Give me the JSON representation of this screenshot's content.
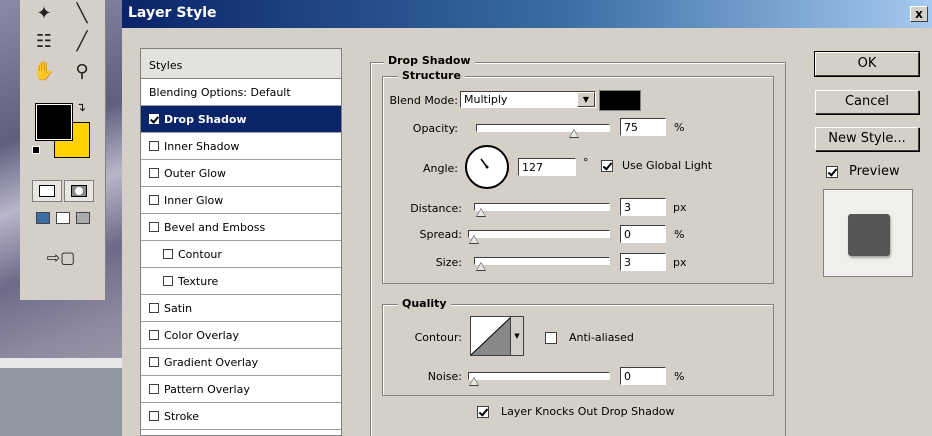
{
  "dialog": {
    "title": "Layer Style",
    "close_label": "x"
  },
  "styles_panel": {
    "header": "Styles",
    "items": [
      {
        "label": "Blending Options: Default",
        "checkbox": false,
        "checked": false,
        "selected": false,
        "indent": false
      },
      {
        "label": "Drop Shadow",
        "checkbox": true,
        "checked": true,
        "selected": true,
        "indent": false
      },
      {
        "label": "Inner Shadow",
        "checkbox": true,
        "checked": false,
        "selected": false,
        "indent": false
      },
      {
        "label": "Outer Glow",
        "checkbox": true,
        "checked": false,
        "selected": false,
        "indent": false
      },
      {
        "label": "Inner Glow",
        "checkbox": true,
        "checked": false,
        "selected": false,
        "indent": false
      },
      {
        "label": "Bevel and Emboss",
        "checkbox": true,
        "checked": false,
        "selected": false,
        "indent": false
      },
      {
        "label": "Contour",
        "checkbox": true,
        "checked": false,
        "selected": false,
        "indent": true
      },
      {
        "label": "Texture",
        "checkbox": true,
        "checked": false,
        "selected": false,
        "indent": true
      },
      {
        "label": "Satin",
        "checkbox": true,
        "checked": false,
        "selected": false,
        "indent": false
      },
      {
        "label": "Color Overlay",
        "checkbox": true,
        "checked": false,
        "selected": false,
        "indent": false
      },
      {
        "label": "Gradient Overlay",
        "checkbox": true,
        "checked": false,
        "selected": false,
        "indent": false
      },
      {
        "label": "Pattern Overlay",
        "checkbox": true,
        "checked": false,
        "selected": false,
        "indent": false
      },
      {
        "label": "Stroke",
        "checkbox": true,
        "checked": false,
        "selected": false,
        "indent": false
      }
    ]
  },
  "drop_shadow": {
    "title": "Drop Shadow",
    "structure": {
      "title": "Structure",
      "blend_mode_label": "Blend Mode:",
      "blend_mode_value": "Multiply",
      "shadow_color": "#000000",
      "opacity_label": "Opacity:",
      "opacity_value": "75",
      "opacity_unit": "%",
      "opacity_slider_fraction": 0.75,
      "angle_label": "Angle:",
      "angle_value": "127",
      "angle_unit": "°",
      "use_global_light_label": "Use Global Light",
      "use_global_light_checked": true,
      "distance_label": "Distance:",
      "distance_value": "3",
      "distance_unit": "px",
      "distance_slider_fraction": 0.01,
      "spread_label": "Spread:",
      "spread_value": "0",
      "spread_unit": "%",
      "spread_slider_fraction": 0.0,
      "size_label": "Size:",
      "size_value": "3",
      "size_unit": "px",
      "size_slider_fraction": 0.01
    },
    "quality": {
      "title": "Quality",
      "contour_label": "Contour:",
      "anti_aliased_label": "Anti-aliased",
      "anti_aliased_checked": false,
      "noise_label": "Noise:",
      "noise_value": "0",
      "noise_unit": "%",
      "noise_slider_fraction": 0.0
    },
    "knockout_label": "Layer Knocks Out Drop Shadow",
    "knockout_checked": true
  },
  "buttons": {
    "ok": "OK",
    "cancel": "Cancel",
    "new_style": "New Style..."
  },
  "preview": {
    "label": "Preview",
    "checked": true
  },
  "colors": {
    "title_bar_start": "#0a246a",
    "selection": "#0a246a",
    "foreground_swatch": "#000000",
    "background_swatch": "#ffd200",
    "preview_swatch": "#555555"
  },
  "toolbox": {
    "icons": [
      "magic-wand-icon",
      "line-tool-icon",
      "notes-icon",
      "eyedropper-icon",
      "hand-icon",
      "zoom-icon",
      "swap-colors-icon",
      "standard-mode-icon",
      "quick-mask-icon",
      "screen-mode-icon",
      "jump-to-imageready-icon"
    ]
  }
}
